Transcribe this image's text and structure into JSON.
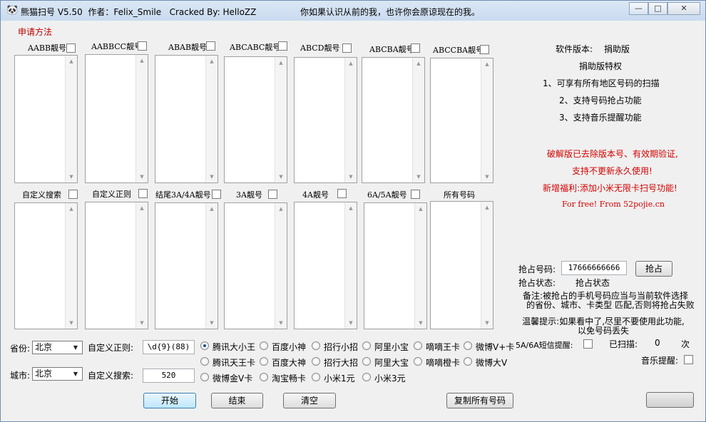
{
  "window": {
    "title": "熊猫扫号 V5.50  作者：Felix_Smile   Cracked By: HelloZZ",
    "motto": "你如果认识从前的我，也许你会原谅现在的我。",
    "minimize": "—",
    "maximize": "□",
    "close": "✕"
  },
  "apply_link": "申请方法",
  "groups_row1": [
    {
      "label": "AABB靓号"
    },
    {
      "label": "AABBCC靓号"
    },
    {
      "label": "ABAB靓号"
    },
    {
      "label": "ABCABC靓号"
    },
    {
      "label": "ABCD靓号"
    },
    {
      "label": "ABCBA靓号"
    },
    {
      "label": "ABCCBA靓号"
    }
  ],
  "groups_row2": [
    {
      "label": "自定义搜索"
    },
    {
      "label": "自定义正则"
    },
    {
      "label": "结尾3A/4A靓号"
    },
    {
      "label": "3A靓号"
    },
    {
      "label": "4A靓号"
    },
    {
      "label": "6A/5A靓号"
    },
    {
      "label": "所有号码"
    }
  ],
  "form": {
    "province_label": "省份:",
    "province_value": "北京",
    "city_label": "城市:",
    "city_value": "北京",
    "regex_label": "自定义正则:",
    "regex_value": "\\d{9}(88)",
    "search_label": "自定义搜索:",
    "search_value": "520"
  },
  "radios": [
    {
      "label": "腾讯大小王",
      "checked": true
    },
    {
      "label": "百度小神",
      "checked": false
    },
    {
      "label": "招行小招",
      "checked": false
    },
    {
      "label": "阿里小宝",
      "checked": false
    },
    {
      "label": "嘀嘀王卡",
      "checked": false
    },
    {
      "label": "微博V+卡",
      "checked": false
    },
    {
      "label": "腾讯天王卡",
      "checked": false
    },
    {
      "label": "百度大神",
      "checked": false
    },
    {
      "label": "招行大招",
      "checked": false
    },
    {
      "label": "阿里大宝",
      "checked": false
    },
    {
      "label": "嘀嘀橙卡",
      "checked": false
    },
    {
      "label": "微博大V",
      "checked": false
    },
    {
      "label": "微博金V卡",
      "checked": false
    },
    {
      "label": "淘宝畅卡",
      "checked": false
    },
    {
      "label": "小米1元",
      "checked": false
    },
    {
      "label": "小米3元",
      "checked": false
    }
  ],
  "buttons": {
    "start": "开始",
    "stop": "结束",
    "clear": "清空",
    "copy_all": "复制所有号码",
    "grab": "抢占"
  },
  "info": {
    "version_label": "软件版本:",
    "version_value": "捐助版",
    "privilege_title": "捐助版特权",
    "privilege_1": "1、可享有所有地区号码的扫描",
    "privilege_2": "2、支持号码抢占功能",
    "privilege_3": "3、支持音乐提醒功能",
    "crack_1": "破解版已去除版本号、有效期验证,",
    "crack_2": "支持不更新永久使用!",
    "crack_3": "新增福利:添加小米无限卡扫号功能!",
    "crack_4": "For free! From 52pojie.cn"
  },
  "grab": {
    "number_label": "抢占号码:",
    "number_value": "17666666666",
    "status_label": "抢占状态:",
    "status_value": "抢占状态",
    "note_1": "备注:被抢占的手机号码应当与当前软件选择",
    "note_2": "的省份、城市、卡类型 匹配,否则将抢占失败",
    "tip_1": "温馨提示:如果看中了,尽里不要使用此功能,",
    "tip_2": "以免号码丢失",
    "sms_label": "5A/6A短信提醒:",
    "scanned_label": "已扫描:",
    "scanned_value": "0",
    "scanned_unit": "次",
    "music_label": "音乐提醒:"
  },
  "colors": {
    "accent_red": "#d40000",
    "radio_dot": "#1c4f9c"
  }
}
